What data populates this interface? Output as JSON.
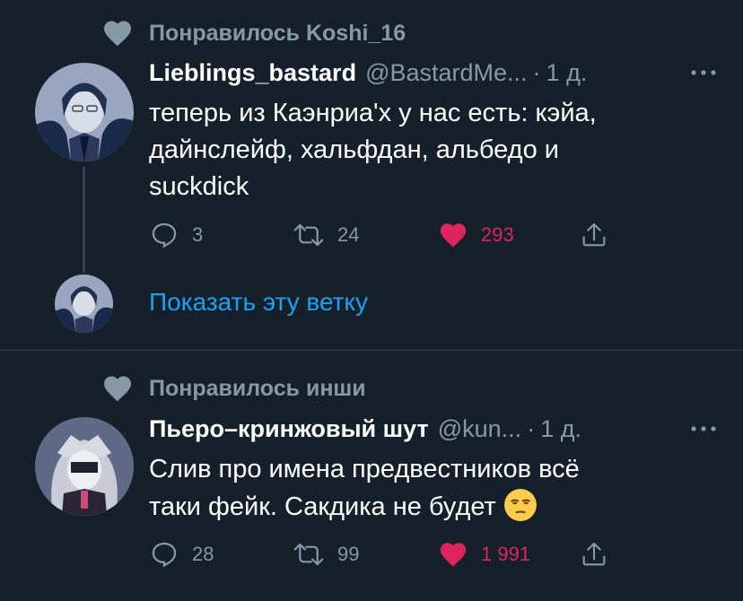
{
  "tweets": [
    {
      "liked_by": "Понравилось Koshi_16",
      "display_name": "Lieblings_bastard",
      "handle": "@BastardMe...",
      "separator": "·",
      "time": "1 д.",
      "text_lines": [
        "теперь из Каэнриа'х у нас есть: кэйа,",
        "дайнслейф, хальфдан, альбедо и",
        "suckdick"
      ],
      "replies": "3",
      "retweets": "24",
      "likes": "293",
      "liked": true,
      "show_thread": "Показать эту ветку"
    },
    {
      "liked_by": "Понравилось инши",
      "display_name": "Пьеро–кринжовый шут",
      "handle": "@kun...",
      "separator": "·",
      "time": "1 д.",
      "text_lines": [
        "Слив про имена предвестников всё",
        "таки фейк. Сакдика не будет"
      ],
      "emoji": "unamused-face-emoji",
      "replies": "28",
      "retweets": "99",
      "likes": "1 991",
      "liked": true
    }
  ],
  "icons": {
    "context": "heart-icon",
    "reply": "reply-icon",
    "retweet": "retweet-icon",
    "like": "heart-filled-icon",
    "share": "share-icon",
    "more": "more-icon"
  },
  "colors": {
    "background": "#15202b",
    "secondary_text": "#8899a6",
    "link": "#1da1f2",
    "like": "#e0245e",
    "divider": "#38444d"
  }
}
